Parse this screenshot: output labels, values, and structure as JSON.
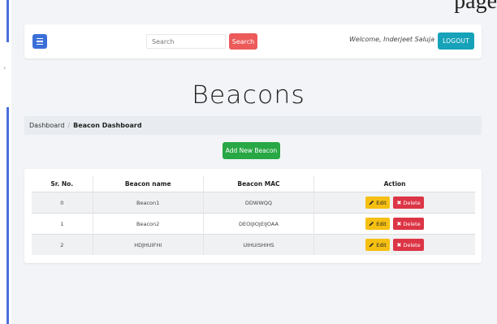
{
  "corner_text": "page",
  "navbar": {
    "menu_icon": "hamburger-icon",
    "search_placeholder": "Search",
    "search_button": "Search",
    "welcome_text": "Welcome, Inderjeet Saluja",
    "logout_button": "LOGOUT"
  },
  "page_title": "Beacons",
  "breadcrumb": {
    "home": "Dashboard",
    "separator": "/",
    "current": "Beacon Dashboard"
  },
  "add_button": "Add New Beacon",
  "table": {
    "headers": [
      "Sr. No.",
      "Beacon name",
      "Beacon MAC",
      "Action"
    ],
    "rows": [
      {
        "sr": "0",
        "name": "Beacon1",
        "mac": "DDWWQQ"
      },
      {
        "sr": "1",
        "name": "Beacon2",
        "mac": "DEOIJIOJEIJOAA"
      },
      {
        "sr": "2",
        "name": "HDJHUIFHI",
        "mac": "UIHUISHIHS"
      }
    ],
    "edit_label": "Edit",
    "delete_label": "Delete",
    "edit_icon": "pencil-icon",
    "delete_icon": "close-icon"
  },
  "colors": {
    "menu": "#3b6fd8",
    "search_button": "#ec5a5a",
    "logout": "#16a2b8",
    "add": "#28a745",
    "edit": "#f5c012",
    "delete": "#dc3545"
  }
}
